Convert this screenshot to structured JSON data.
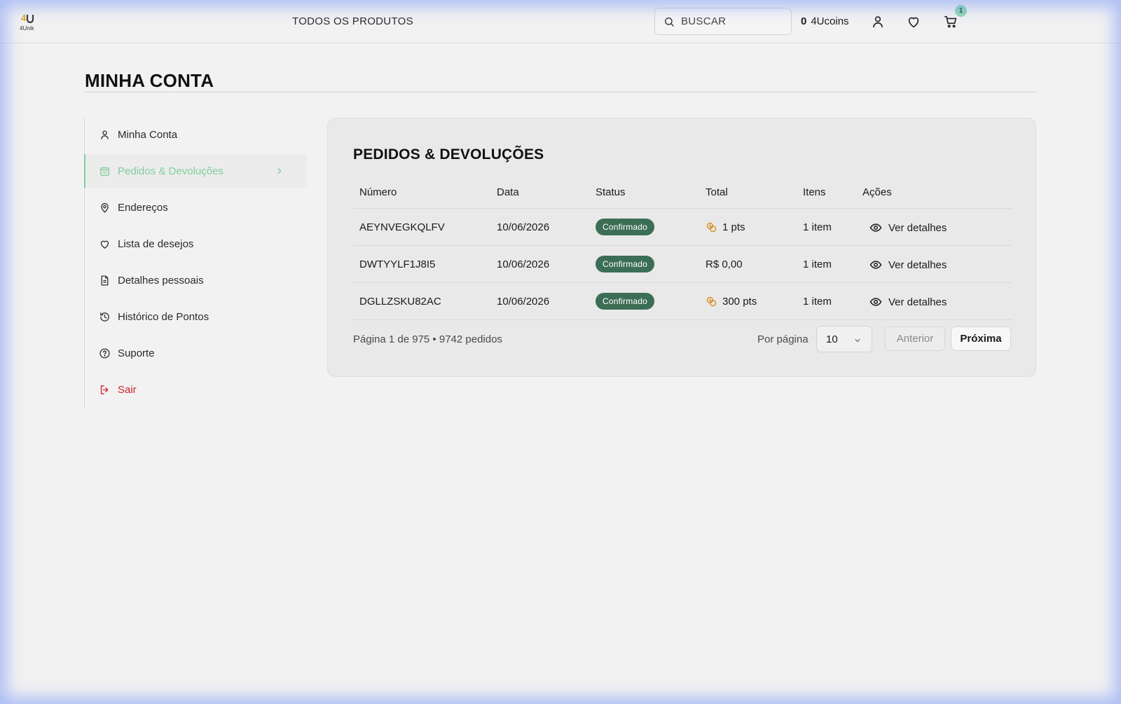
{
  "header": {
    "logo_text": "4Unik",
    "nav_all_products": "TODOS OS PRODUTOS",
    "search_placeholder": "BUSCAR",
    "coins_count": "0",
    "coins_label": "4Ucoins",
    "cart_count": "1"
  },
  "page": {
    "title": "MINHA CONTA"
  },
  "sidebar": {
    "items": [
      {
        "label": "Minha Conta",
        "icon": "user-icon"
      },
      {
        "label": "Pedidos & Devoluções",
        "icon": "bag-icon",
        "active": true
      },
      {
        "label": "Endereços",
        "icon": "map-pin-icon"
      },
      {
        "label": "Lista de desejos",
        "icon": "heart-icon"
      },
      {
        "label": "Detalhes pessoais",
        "icon": "document-icon"
      },
      {
        "label": "Histórico de Pontos",
        "icon": "history-icon"
      },
      {
        "label": "Suporte",
        "icon": "help-icon"
      },
      {
        "label": "Sair",
        "icon": "logout-icon"
      }
    ]
  },
  "orders": {
    "title": "PEDIDOS & DEVOLUÇÕES",
    "columns": [
      "Número",
      "Data",
      "Status",
      "Total",
      "Itens",
      "Ações"
    ],
    "rows": [
      {
        "number": "AEYNVEGKQLFV",
        "date": "10/06/2026",
        "status": "Confirmado",
        "total": "1 pts",
        "total_is_points": true,
        "items": "1 item",
        "action": "Ver detalhes"
      },
      {
        "number": "DWTYYLF1J8I5",
        "date": "10/06/2026",
        "status": "Confirmado",
        "total": "R$ 0,00",
        "total_is_points": false,
        "items": "1 item",
        "action": "Ver detalhes"
      },
      {
        "number": "DGLLZSKU82AC",
        "date": "10/06/2026",
        "status": "Confirmado",
        "total": "300 pts",
        "total_is_points": true,
        "items": "1 item",
        "action": "Ver detalhes"
      }
    ],
    "pagination": {
      "info": "Página 1 de 975 • 9742 pedidos",
      "per_page_label": "Por página",
      "per_page_value": "10",
      "prev_label": "Anterior",
      "next_label": "Próxima"
    }
  },
  "colors": {
    "accent_green": "#7fce9a",
    "status_badge": "#3c6e55",
    "points_orange": "#d98a1e",
    "logout_red": "#d0242d"
  }
}
